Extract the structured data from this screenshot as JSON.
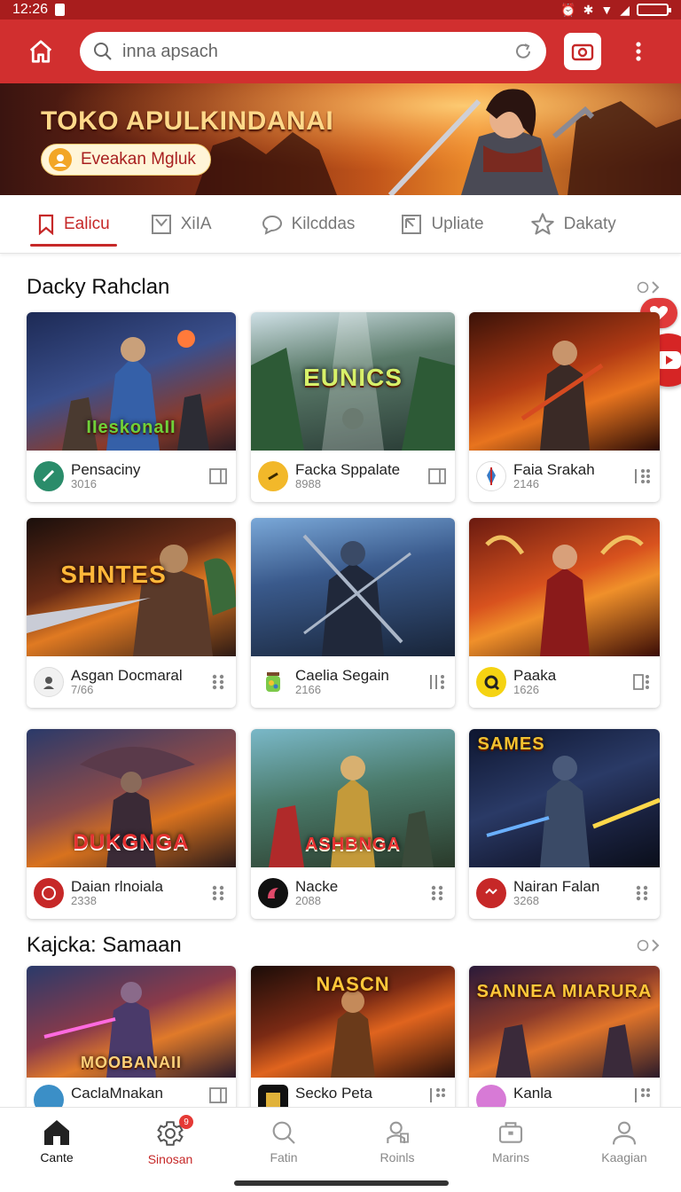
{
  "status": {
    "time": "12:26"
  },
  "search": {
    "placeholder": "inna apsach"
  },
  "banner": {
    "title": "TOKO APULKINDANAI",
    "button_label": "Eveakan Mgluk"
  },
  "tabs": [
    {
      "label": "Ealicu",
      "icon": "bookmark-icon",
      "active": true
    },
    {
      "label": "XiIA",
      "icon": "frame-icon"
    },
    {
      "label": "Kilcddas",
      "icon": "chat-bubble-icon"
    },
    {
      "label": "Upliate",
      "icon": "image-frame-icon"
    },
    {
      "label": "Dakaty",
      "icon": "star-icon"
    }
  ],
  "sections": [
    {
      "title": "Dacky Rahclan",
      "apps": [
        {
          "name": "Pensaciny",
          "count": "3016",
          "art_text": "IIeskonaII",
          "icon_color": "#2a8c6a"
        },
        {
          "name": "Facka Sppalate",
          "count": "8988",
          "art_text": "EUNICS",
          "icon_color": "#f2b82a"
        },
        {
          "name": "Faia Srakah",
          "count": "2146",
          "art_text": "",
          "icon_color": "#3a79c4"
        },
        {
          "name": "Asgan Docmaral",
          "count": "7/66",
          "art_text": "SHNTES",
          "icon_color": "#d9d9d9"
        },
        {
          "name": "Caelia Segain",
          "count": "2166",
          "art_text": "",
          "icon_color": "#7cc94a"
        },
        {
          "name": "Paaka",
          "count": "1626",
          "art_text": "",
          "icon_color": "#f5d312"
        },
        {
          "name": "Daian rlnoiala",
          "count": "2338",
          "art_text": "DUKGNGA",
          "icon_color": "#c62828"
        },
        {
          "name": "Nacke",
          "count": "2088",
          "art_text": "ASHBNGA",
          "icon_color": "#111111"
        },
        {
          "name": "Nairan Falan",
          "count": "3268",
          "art_text": "SAMES",
          "icon_color": "#c62828"
        }
      ]
    },
    {
      "title": "Kajcka: Samaan",
      "apps": [
        {
          "name": "CaclaMnakan",
          "count": "",
          "art_text": "MOOBANAII",
          "icon_color": "#3b8fc7"
        },
        {
          "name": "Secko Peta",
          "count": "",
          "art_text": "NASCN",
          "icon_color": "#e0b23a"
        },
        {
          "name": "Kanla",
          "count": "",
          "art_text": "SANNEA MIARURA",
          "icon_color": "#d77ad6"
        }
      ]
    }
  ],
  "bottom_nav": [
    {
      "label": "Cante",
      "icon": "home-icon"
    },
    {
      "label": "Sinosan",
      "icon": "gear-icon",
      "badge": "9"
    },
    {
      "label": "Fatin",
      "icon": "search-icon"
    },
    {
      "label": "Roinls",
      "icon": "person-badge-icon"
    },
    {
      "label": "Marins",
      "icon": "briefcase-icon"
    },
    {
      "label": "Kaagian",
      "icon": "user-icon"
    }
  ],
  "colors": {
    "brand_red": "#d12f2f",
    "status_red": "#a81d1d",
    "active_red": "#c62828"
  }
}
